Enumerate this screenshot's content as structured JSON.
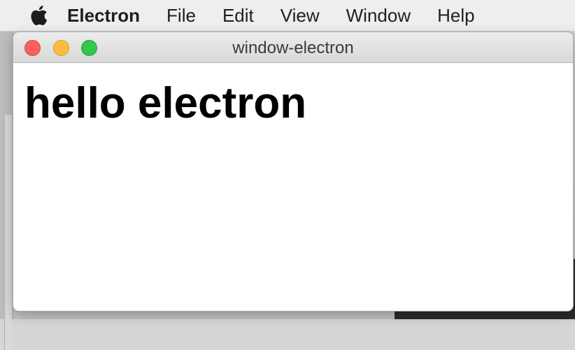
{
  "menubar": {
    "apple_icon": "apple-logo-icon",
    "items": [
      "Electron",
      "File",
      "Edit",
      "View",
      "Window",
      "Help"
    ]
  },
  "window": {
    "title": "window-electron",
    "controls": {
      "close_color": "#fc605c",
      "minimize_color": "#fdbc40",
      "zoom_color": "#34c84a"
    },
    "content": {
      "heading": "hello electron"
    }
  }
}
